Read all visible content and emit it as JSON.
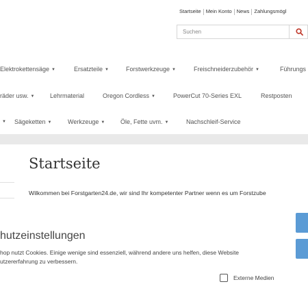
{
  "top_links": {
    "home": "Startseite",
    "account": "Mein Konto",
    "news": "News",
    "payment": "Zahlungsmögl"
  },
  "search": {
    "placeholder": "Suchen",
    "icon": "search-icon",
    "accent": "#c0392b"
  },
  "nav": {
    "row1": [
      "Elektrokettensäge",
      "Ersatzteile",
      "Forstwerkzeuge",
      "Freischneiderzubehör",
      "Führungs"
    ],
    "row2": [
      "räder usw.",
      "Lehrmaterial",
      "Oregon Cordless",
      "PowerCut 70-Series EXL",
      "Restposten"
    ],
    "row3": [
      "Sägeketten",
      "Werkzeuge",
      "Öle, Fette uvm.",
      "Nachschleif-Service"
    ]
  },
  "main": {
    "title": "Startseite",
    "welcome": "Wilkommen bei Forstgarten24.de, wir sind Ihr kompetenter Partner wenn es um Forstzube"
  },
  "cookie": {
    "title": "hutzeinstellungen",
    "line1": "hop nutzt Cookies. Einige wenige sind essenziell, während andere uns helfen, diese Website",
    "line2": "utzererfahrung zu verbessern.",
    "checkbox_label": "Externe Medien",
    "button_color": "#5b9bd5"
  }
}
